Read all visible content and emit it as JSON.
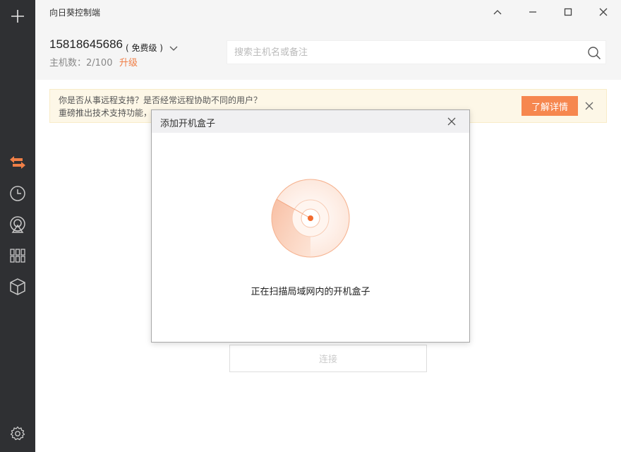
{
  "app": {
    "title": "向日葵控制端"
  },
  "account": {
    "phone": "15818645686",
    "level": "( 免费级 )",
    "host_count_label": "主机数：2/100",
    "upgrade_label": "升级"
  },
  "search": {
    "placeholder": "搜索主机名或备注"
  },
  "banner": {
    "line1": "你是否从事远程支持？是否经常远程协助不同的用户？",
    "line2": "重磅推出技术支持功能，",
    "button_label": "了解详情"
  },
  "connect_button_label": "连接",
  "modal": {
    "title": "添加开机盒子",
    "status_text": "正在扫描局域网内的开机盒子"
  },
  "colors": {
    "accent": "#f6874f",
    "sidebar_bg": "#2f3033",
    "active_icon": "#f07f47"
  }
}
